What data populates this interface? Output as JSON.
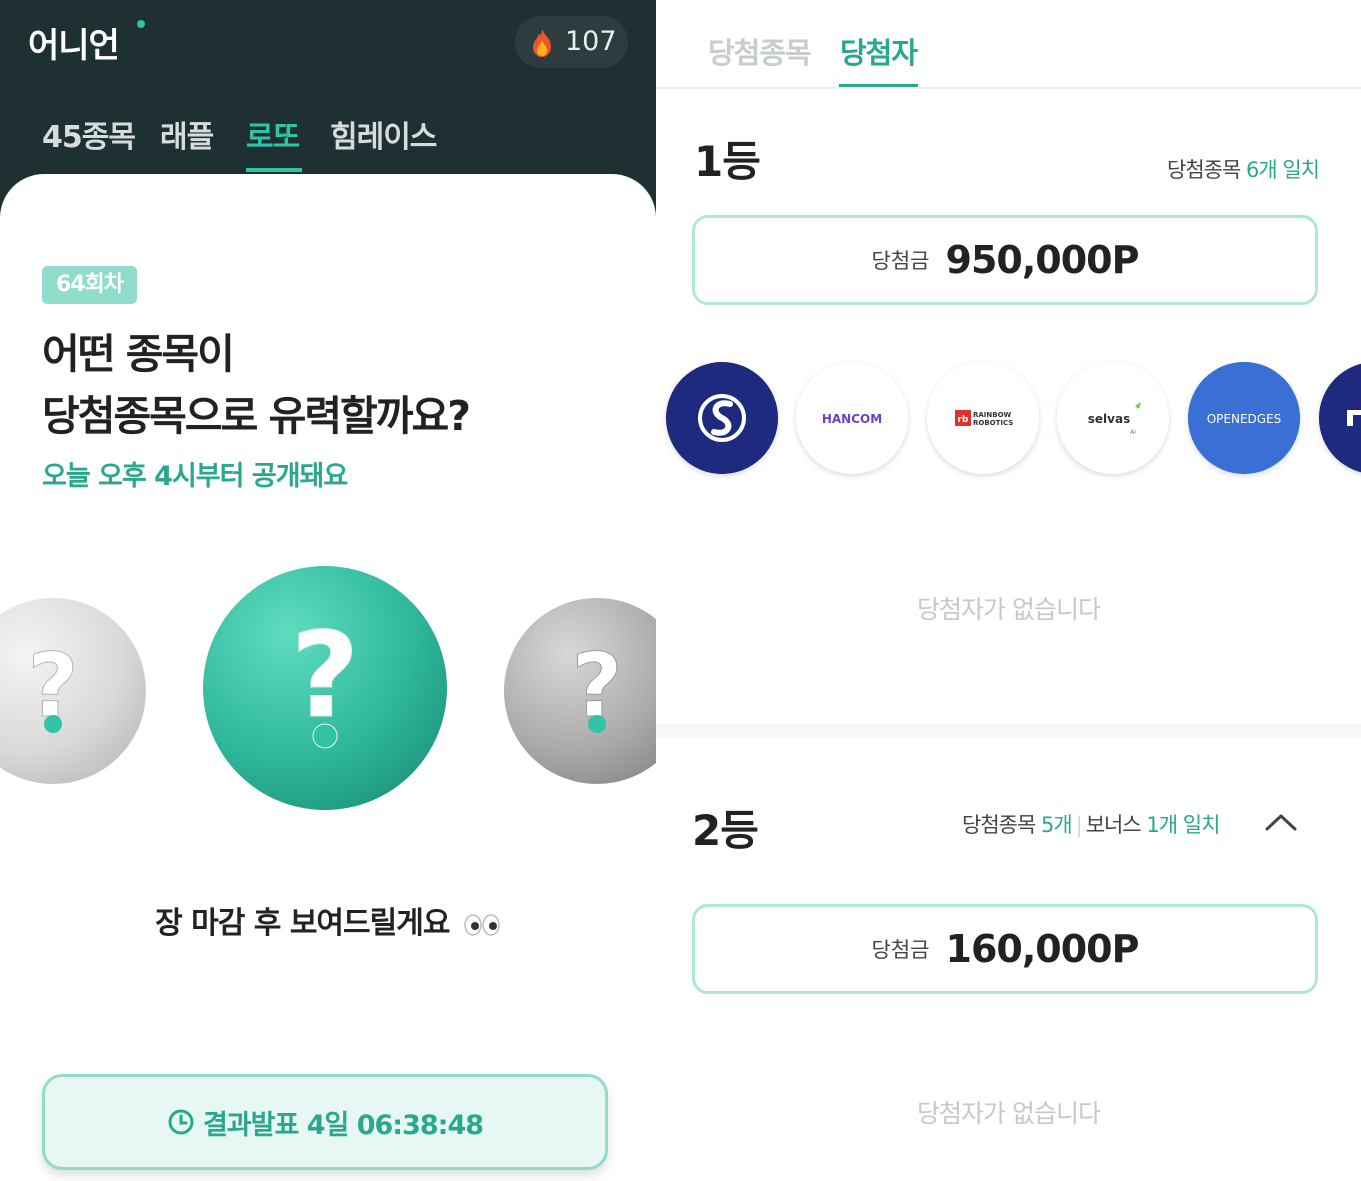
{
  "left": {
    "header": {
      "logo": "어니언",
      "points": "107",
      "nav_tabs": [
        {
          "label": "45종목",
          "active": false
        },
        {
          "label": "래플",
          "active": false
        },
        {
          "label": "로또",
          "active": true
        },
        {
          "label": "힘레이스",
          "active": false
        }
      ]
    },
    "content": {
      "round_badge": "64회차",
      "headline_line1": "어떤 종목이",
      "headline_line2": "당첨종목으로 유력할까요?",
      "subline": "오늘 오후 4시부터 공개돼요",
      "after_close_text": "장 마감 후 보여드릴게요",
      "result_button_label": "결과발표 4일 06:38:48"
    },
    "colors": {
      "header_bg": "#1f3033",
      "accent": "#2ec4a5",
      "accent_dark": "#2aa88e"
    }
  },
  "right": {
    "tabs": [
      {
        "label": "당첨종목",
        "active": false
      },
      {
        "label": "당첨자",
        "active": true
      }
    ],
    "prizes": [
      {
        "rank": "1등",
        "match_label": "당첨종목",
        "match_count": "6개 일치",
        "prize_label": "당첨금",
        "prize_amount": "950,000P",
        "no_winner_text": "당첨자가 없습니다"
      },
      {
        "rank": "2등",
        "match_label": "당첨종목",
        "match_count": "5개",
        "bonus_label": "보너스",
        "bonus_count": "1개 일치",
        "prize_label": "당첨금",
        "prize_amount": "160,000P",
        "no_winner_text": "당첨자가 없습니다"
      }
    ],
    "stock_logos": [
      {
        "icon": "shinhan-logo-icon",
        "text": ""
      },
      {
        "icon": "hancom-logo-icon",
        "text": "HANCOM"
      },
      {
        "icon": "rainbow-robotics-logo-icon",
        "text_line1": "RAINBOW",
        "text_line2": "ROBOTICS"
      },
      {
        "icon": "selvas-logo-icon",
        "text": "selvas"
      },
      {
        "icon": "openedges-logo-icon",
        "text": "OPENEDGES"
      },
      {
        "icon": "partial-logo-icon",
        "text": ""
      }
    ]
  }
}
